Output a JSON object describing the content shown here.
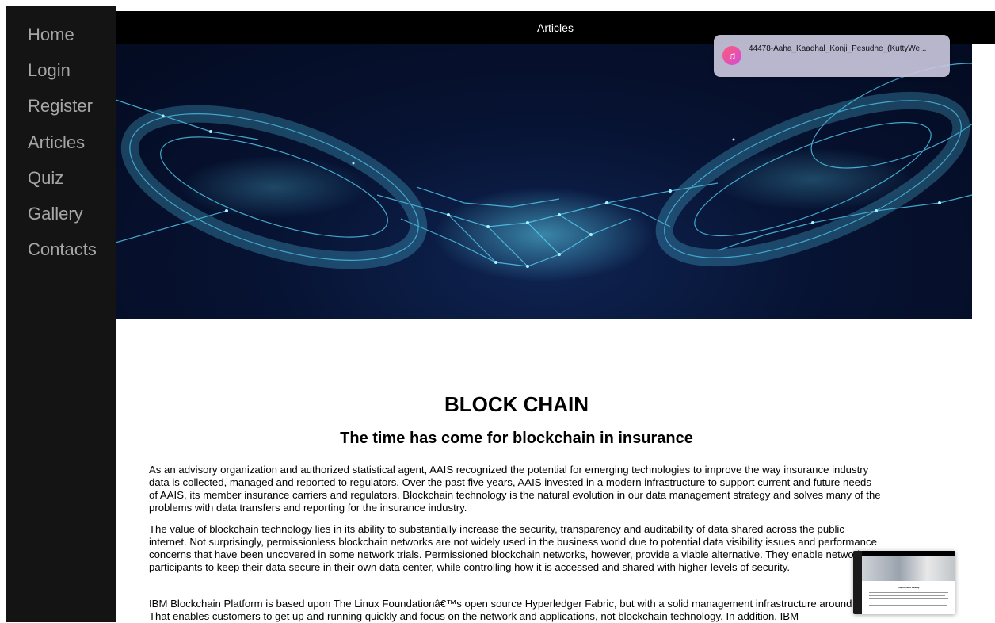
{
  "sidebar": {
    "items": [
      {
        "label": "Home"
      },
      {
        "label": "Login"
      },
      {
        "label": "Register"
      },
      {
        "label": "Articles"
      },
      {
        "label": "Quiz"
      },
      {
        "label": "Gallery"
      },
      {
        "label": "Contacts"
      }
    ]
  },
  "header": {
    "title": "Articles"
  },
  "hero": {
    "icon": "blockchain-handshake-image"
  },
  "article": {
    "title": "BLOCK CHAIN",
    "subtitle": "The time has come for blockchain in insurance",
    "paragraphs": [
      "As an advisory organization and authorized statistical agent, AAIS recognized the potential for emerging technologies to improve the way insurance industry data is collected, managed and reported to regulators. Over the past five years, AAIS invested in a modern infrastructure to support current and future needs of AAIS, its member insurance carriers and regulators. Blockchain technology is the natural evolution in our data management strategy and solves many of the problems with data transfers and reporting for the insurance industry.",
      "The value of blockchain technology lies in its ability to substantially increase the security, transparency and auditability of data shared across the public internet. Not surprisingly, permissionless blockchain networks are not widely used in the business world due to potential data visibility issues and performance concerns that have been uncovered in some network trials. Permissioned blockchain networks, however, provide a viable alternative. They enable network participants to keep their data secure in their own data center, while controlling how it is accessed and shared with higher levels of security.",
      "IBM Blockchain Platform is based upon The Linux Foundationâ€™s open source Hyperledger Fabric, but with a solid management infrastructure around it. That enables customers to get up and running quickly and focus on the network and applications, not blockchain technology. In addition, IBM"
    ]
  },
  "notification": {
    "text": "44478-Aaha_Kaadhal_Konji_Pesudhe_(KuttyWe...",
    "icon": "music-note-icon"
  },
  "thumbnail": {
    "title": "Augmented Reality"
  },
  "colors": {
    "sidebar_bg": "#141414",
    "sidebar_text": "#a6a6a6",
    "topbar_bg": "#000000",
    "hero_bg": "#071333",
    "hero_accent": "#4fc3e8"
  }
}
